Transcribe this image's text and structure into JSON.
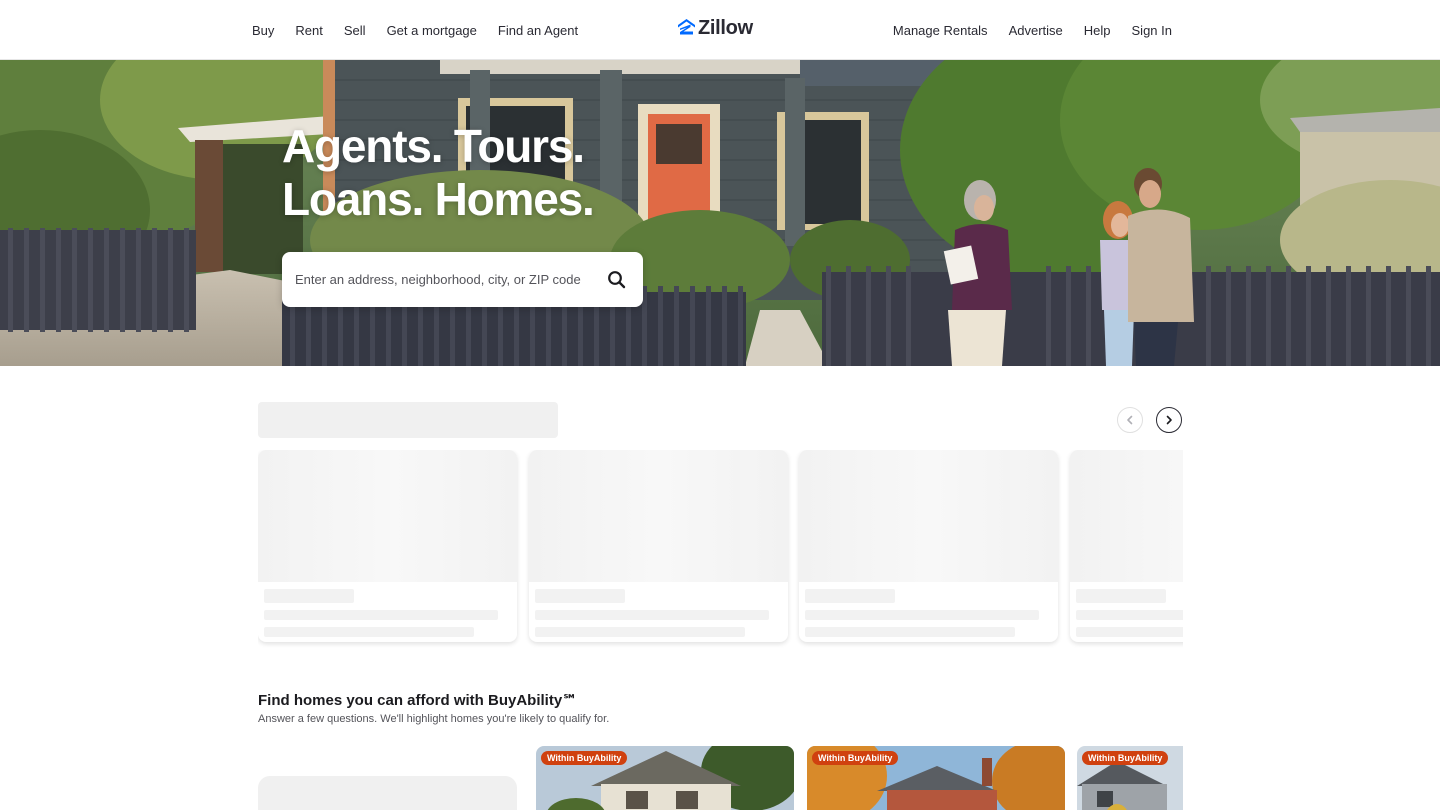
{
  "header": {
    "nav_left": [
      "Buy",
      "Rent",
      "Sell",
      "Get a mortgage",
      "Find an Agent"
    ],
    "logo_text": "Zillow",
    "nav_right": [
      "Manage Rentals",
      "Advertise",
      "Help",
      "Sign In"
    ],
    "brand_color": "#006AFF"
  },
  "hero": {
    "title_line1": "Agents. Tours.",
    "title_line2": "Loans. Homes.",
    "search_placeholder": "Enter an address, neighborhood, city, or ZIP code",
    "search_icon": "search-icon"
  },
  "carousel": {
    "prev_icon": "chevron-left-icon",
    "next_icon": "chevron-right-icon"
  },
  "buyability": {
    "title": "Find homes you can afford with BuyAbility℠",
    "subtitle": "Answer a few questions. We'll highlight homes you're likely to qualify for.",
    "cards": [
      {
        "badge": "Within BuyAbility"
      },
      {
        "badge": "Within BuyAbility"
      },
      {
        "badge": "Within BuyAbility"
      }
    ],
    "badge_color": "#D0410F"
  }
}
